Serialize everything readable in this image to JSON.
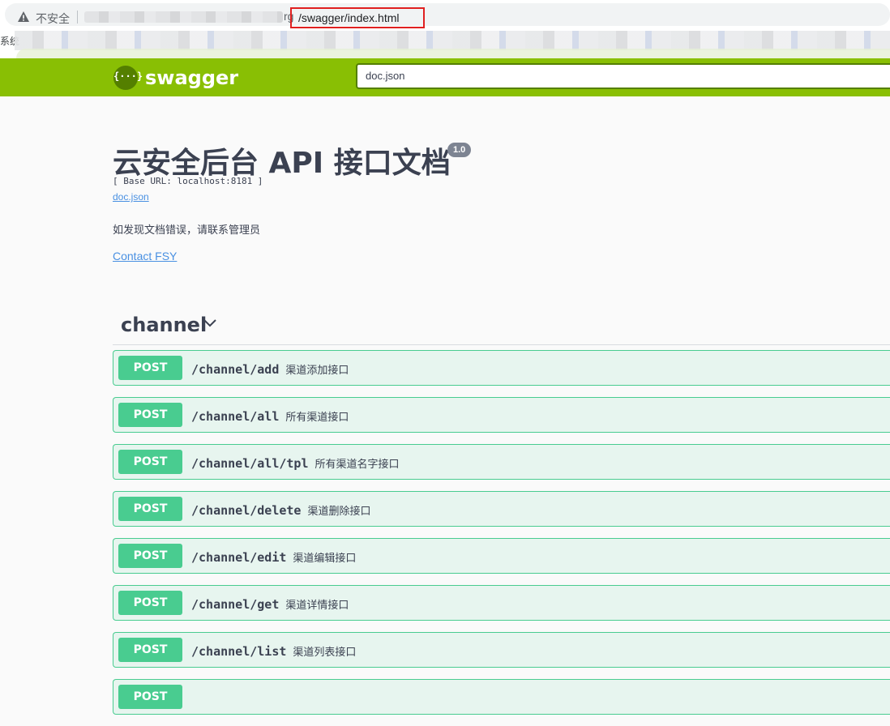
{
  "browser": {
    "insecure_label": "不安全",
    "domain_tail": "rg",
    "url_path": "/swagger/index.html",
    "bookmark_label": "系统"
  },
  "topbar": {
    "logo_text": "swagger",
    "logo_glyph": "{···}",
    "spec_url": "doc.json"
  },
  "info": {
    "title": "云安全后台 API 接口文档",
    "version": "1.0",
    "base_url": "[ Base URL: localhost:8181 ]",
    "doc_link": "doc.json",
    "description": "如发现文档错误，请联系管理员",
    "contact": "Contact FSY"
  },
  "tag": {
    "name": "channel"
  },
  "operations": [
    {
      "method": "POST",
      "path": "/channel/add",
      "summary": "渠道添加接口"
    },
    {
      "method": "POST",
      "path": "/channel/all",
      "summary": "所有渠道接口"
    },
    {
      "method": "POST",
      "path": "/channel/all/tpl",
      "summary": "所有渠道名字接口"
    },
    {
      "method": "POST",
      "path": "/channel/delete",
      "summary": "渠道删除接口"
    },
    {
      "method": "POST",
      "path": "/channel/edit",
      "summary": "渠道编辑接口"
    },
    {
      "method": "POST",
      "path": "/channel/get",
      "summary": "渠道详情接口"
    },
    {
      "method": "POST",
      "path": "/channel/list",
      "summary": "渠道列表接口"
    },
    {
      "method": "POST",
      "path": "",
      "summary": ""
    }
  ],
  "colors": {
    "topbar": "#89bf04",
    "post": "#49cc90",
    "highlight_box": "#e02020",
    "link": "#4990e2"
  }
}
